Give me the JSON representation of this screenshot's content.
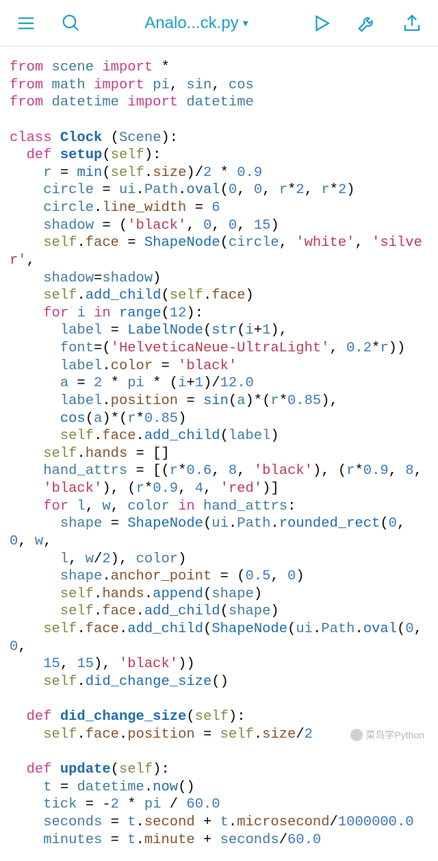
{
  "toolbar": {
    "title": "Analo...ck.py",
    "icons": {
      "menu": "hamburger-icon",
      "search": "search-icon",
      "play": "play-icon",
      "wrench": "wrench-icon",
      "export": "export-icon",
      "dropdown": "▾"
    }
  },
  "watermark": "菜鸟学Python",
  "code_tokens": [
    [
      [
        "kw",
        "from"
      ],
      [
        "op",
        " "
      ],
      [
        "nm",
        "scene"
      ],
      [
        "op",
        " "
      ],
      [
        "kw",
        "import"
      ],
      [
        "op",
        " *"
      ]
    ],
    [
      [
        "kw",
        "from"
      ],
      [
        "op",
        " "
      ],
      [
        "nm",
        "math"
      ],
      [
        "op",
        " "
      ],
      [
        "kw",
        "import"
      ],
      [
        "op",
        " "
      ],
      [
        "nm",
        "pi"
      ],
      [
        "op",
        ", "
      ],
      [
        "nm",
        "sin"
      ],
      [
        "op",
        ", "
      ],
      [
        "nm",
        "cos"
      ]
    ],
    [
      [
        "kw",
        "from"
      ],
      [
        "op",
        " "
      ],
      [
        "nm",
        "datetime"
      ],
      [
        "op",
        " "
      ],
      [
        "kw",
        "import"
      ],
      [
        "op",
        " "
      ],
      [
        "nm",
        "datetime"
      ]
    ],
    [],
    [
      [
        "kw",
        "class"
      ],
      [
        "op",
        " "
      ],
      [
        "cls",
        "Clock"
      ],
      [
        "op",
        " ("
      ],
      [
        "nm",
        "Scene"
      ],
      [
        "op",
        "):"
      ]
    ],
    [
      [
        "op",
        "  "
      ],
      [
        "kw",
        "def"
      ],
      [
        "op",
        " "
      ],
      [
        "fn",
        "setup"
      ],
      [
        "op",
        "("
      ],
      [
        "self",
        "self"
      ],
      [
        "op",
        "):"
      ]
    ],
    [
      [
        "op",
        "    "
      ],
      [
        "nm",
        "r"
      ],
      [
        "op",
        " = "
      ],
      [
        "call",
        "min"
      ],
      [
        "op",
        "("
      ],
      [
        "self",
        "self"
      ],
      [
        "op",
        "."
      ],
      [
        "attr",
        "size"
      ],
      [
        "op",
        ")/"
      ],
      [
        "num",
        "2"
      ],
      [
        "op",
        " * "
      ],
      [
        "num",
        "0.9"
      ]
    ],
    [
      [
        "op",
        "    "
      ],
      [
        "nm",
        "circle"
      ],
      [
        "op",
        " = "
      ],
      [
        "nm",
        "ui"
      ],
      [
        "op",
        "."
      ],
      [
        "nm",
        "Path"
      ],
      [
        "op",
        "."
      ],
      [
        "call",
        "oval"
      ],
      [
        "op",
        "("
      ],
      [
        "num",
        "0"
      ],
      [
        "op",
        ", "
      ],
      [
        "num",
        "0"
      ],
      [
        "op",
        ", "
      ],
      [
        "nm",
        "r"
      ],
      [
        "op",
        "*"
      ],
      [
        "num",
        "2"
      ],
      [
        "op",
        ", "
      ],
      [
        "nm",
        "r"
      ],
      [
        "op",
        "*"
      ],
      [
        "num",
        "2"
      ],
      [
        "op",
        ")"
      ]
    ],
    [
      [
        "op",
        "    "
      ],
      [
        "nm",
        "circle"
      ],
      [
        "op",
        "."
      ],
      [
        "attr",
        "line_width"
      ],
      [
        "op",
        " = "
      ],
      [
        "num",
        "6"
      ]
    ],
    [
      [
        "op",
        "    "
      ],
      [
        "nm",
        "shadow"
      ],
      [
        "op",
        " = ("
      ],
      [
        "str",
        "'black'"
      ],
      [
        "op",
        ", "
      ],
      [
        "num",
        "0"
      ],
      [
        "op",
        ", "
      ],
      [
        "num",
        "0"
      ],
      [
        "op",
        ", "
      ],
      [
        "num",
        "15"
      ],
      [
        "op",
        ")"
      ]
    ],
    [
      [
        "op",
        "    "
      ],
      [
        "self",
        "self"
      ],
      [
        "op",
        "."
      ],
      [
        "attr",
        "face"
      ],
      [
        "op",
        " = "
      ],
      [
        "call",
        "ShapeNode"
      ],
      [
        "op",
        "("
      ],
      [
        "nm",
        "circle"
      ],
      [
        "op",
        ", "
      ],
      [
        "str",
        "'white'"
      ],
      [
        "op",
        ", "
      ],
      [
        "str",
        "'silver'"
      ],
      [
        "op",
        ","
      ]
    ],
    [
      [
        "op",
        "    "
      ],
      [
        "nm",
        "shadow"
      ],
      [
        "op",
        "="
      ],
      [
        "nm",
        "shadow"
      ],
      [
        "op",
        ")"
      ]
    ],
    [
      [
        "op",
        "    "
      ],
      [
        "self",
        "self"
      ],
      [
        "op",
        "."
      ],
      [
        "call",
        "add_child"
      ],
      [
        "op",
        "("
      ],
      [
        "self",
        "self"
      ],
      [
        "op",
        "."
      ],
      [
        "attr",
        "face"
      ],
      [
        "op",
        ")"
      ]
    ],
    [
      [
        "op",
        "    "
      ],
      [
        "kw",
        "for"
      ],
      [
        "op",
        " "
      ],
      [
        "nm",
        "i"
      ],
      [
        "op",
        " "
      ],
      [
        "kw",
        "in"
      ],
      [
        "op",
        " "
      ],
      [
        "call",
        "range"
      ],
      [
        "op",
        "("
      ],
      [
        "num",
        "12"
      ],
      [
        "op",
        "):"
      ]
    ],
    [
      [
        "op",
        "      "
      ],
      [
        "nm",
        "label"
      ],
      [
        "op",
        " = "
      ],
      [
        "call",
        "LabelNode"
      ],
      [
        "op",
        "("
      ],
      [
        "call",
        "str"
      ],
      [
        "op",
        "("
      ],
      [
        "nm",
        "i"
      ],
      [
        "op",
        "+"
      ],
      [
        "num",
        "1"
      ],
      [
        "op",
        "),"
      ]
    ],
    [
      [
        "op",
        "      "
      ],
      [
        "nm",
        "font"
      ],
      [
        "op",
        "=("
      ],
      [
        "str",
        "'HelveticaNeue-UltraLight'"
      ],
      [
        "op",
        ", "
      ],
      [
        "num",
        "0.2"
      ],
      [
        "op",
        "*"
      ],
      [
        "nm",
        "r"
      ],
      [
        "op",
        "))"
      ]
    ],
    [
      [
        "op",
        "      "
      ],
      [
        "nm",
        "label"
      ],
      [
        "op",
        "."
      ],
      [
        "attr",
        "color"
      ],
      [
        "op",
        " = "
      ],
      [
        "str",
        "'black'"
      ]
    ],
    [
      [
        "op",
        "      "
      ],
      [
        "nm",
        "a"
      ],
      [
        "op",
        " = "
      ],
      [
        "num",
        "2"
      ],
      [
        "op",
        " * "
      ],
      [
        "nm",
        "pi"
      ],
      [
        "op",
        " * ("
      ],
      [
        "nm",
        "i"
      ],
      [
        "op",
        "+"
      ],
      [
        "num",
        "1"
      ],
      [
        "op",
        ")/"
      ],
      [
        "num",
        "12.0"
      ]
    ],
    [
      [
        "op",
        "      "
      ],
      [
        "nm",
        "label"
      ],
      [
        "op",
        "."
      ],
      [
        "attr",
        "position"
      ],
      [
        "op",
        " = "
      ],
      [
        "call",
        "sin"
      ],
      [
        "op",
        "("
      ],
      [
        "nm",
        "a"
      ],
      [
        "op",
        ")*("
      ],
      [
        "nm",
        "r"
      ],
      [
        "op",
        "*"
      ],
      [
        "num",
        "0.85"
      ],
      [
        "op",
        "),"
      ]
    ],
    [
      [
        "op",
        "      "
      ],
      [
        "call",
        "cos"
      ],
      [
        "op",
        "("
      ],
      [
        "nm",
        "a"
      ],
      [
        "op",
        ")*("
      ],
      [
        "nm",
        "r"
      ],
      [
        "op",
        "*"
      ],
      [
        "num",
        "0.85"
      ],
      [
        "op",
        ")"
      ]
    ],
    [
      [
        "op",
        "      "
      ],
      [
        "self",
        "self"
      ],
      [
        "op",
        "."
      ],
      [
        "attr",
        "face"
      ],
      [
        "op",
        "."
      ],
      [
        "call",
        "add_child"
      ],
      [
        "op",
        "("
      ],
      [
        "nm",
        "label"
      ],
      [
        "op",
        ")"
      ]
    ],
    [
      [
        "op",
        "    "
      ],
      [
        "self",
        "self"
      ],
      [
        "op",
        "."
      ],
      [
        "attr",
        "hands"
      ],
      [
        "op",
        " = []"
      ]
    ],
    [
      [
        "op",
        "    "
      ],
      [
        "nm",
        "hand_attrs"
      ],
      [
        "op",
        " = [("
      ],
      [
        "nm",
        "r"
      ],
      [
        "op",
        "*"
      ],
      [
        "num",
        "0.6"
      ],
      [
        "op",
        ", "
      ],
      [
        "num",
        "8"
      ],
      [
        "op",
        ", "
      ],
      [
        "str",
        "'black'"
      ],
      [
        "op",
        "), ("
      ],
      [
        "nm",
        "r"
      ],
      [
        "op",
        "*"
      ],
      [
        "num",
        "0.9"
      ],
      [
        "op",
        ", "
      ],
      [
        "num",
        "8"
      ],
      [
        "op",
        ","
      ]
    ],
    [
      [
        "op",
        "    "
      ],
      [
        "str",
        "'black'"
      ],
      [
        "op",
        "), ("
      ],
      [
        "nm",
        "r"
      ],
      [
        "op",
        "*"
      ],
      [
        "num",
        "0.9"
      ],
      [
        "op",
        ", "
      ],
      [
        "num",
        "4"
      ],
      [
        "op",
        ", "
      ],
      [
        "str",
        "'red'"
      ],
      [
        "op",
        ")]"
      ]
    ],
    [
      [
        "op",
        "    "
      ],
      [
        "kw",
        "for"
      ],
      [
        "op",
        " "
      ],
      [
        "nm",
        "l"
      ],
      [
        "op",
        ", "
      ],
      [
        "nm",
        "w"
      ],
      [
        "op",
        ", "
      ],
      [
        "nm",
        "color"
      ],
      [
        "op",
        " "
      ],
      [
        "kw",
        "in"
      ],
      [
        "op",
        " "
      ],
      [
        "nm",
        "hand_attrs"
      ],
      [
        "op",
        ":"
      ]
    ],
    [
      [
        "op",
        "      "
      ],
      [
        "nm",
        "shape"
      ],
      [
        "op",
        " = "
      ],
      [
        "call",
        "ShapeNode"
      ],
      [
        "op",
        "("
      ],
      [
        "nm",
        "ui"
      ],
      [
        "op",
        "."
      ],
      [
        "nm",
        "Path"
      ],
      [
        "op",
        "."
      ],
      [
        "call",
        "rounded_rect"
      ],
      [
        "op",
        "("
      ],
      [
        "num",
        "0"
      ],
      [
        "op",
        ", "
      ],
      [
        "num",
        "0"
      ],
      [
        "op",
        ", "
      ],
      [
        "nm",
        "w"
      ],
      [
        "op",
        ","
      ]
    ],
    [
      [
        "op",
        "      "
      ],
      [
        "nm",
        "l"
      ],
      [
        "op",
        ", "
      ],
      [
        "nm",
        "w"
      ],
      [
        "op",
        "/"
      ],
      [
        "num",
        "2"
      ],
      [
        "op",
        "), "
      ],
      [
        "nm",
        "color"
      ],
      [
        "op",
        ")"
      ]
    ],
    [
      [
        "op",
        "      "
      ],
      [
        "nm",
        "shape"
      ],
      [
        "op",
        "."
      ],
      [
        "attr",
        "anchor_point"
      ],
      [
        "op",
        " = ("
      ],
      [
        "num",
        "0.5"
      ],
      [
        "op",
        ", "
      ],
      [
        "num",
        "0"
      ],
      [
        "op",
        ")"
      ]
    ],
    [
      [
        "op",
        "      "
      ],
      [
        "self",
        "self"
      ],
      [
        "op",
        "."
      ],
      [
        "attr",
        "hands"
      ],
      [
        "op",
        "."
      ],
      [
        "call",
        "append"
      ],
      [
        "op",
        "("
      ],
      [
        "nm",
        "shape"
      ],
      [
        "op",
        ")"
      ]
    ],
    [
      [
        "op",
        "      "
      ],
      [
        "self",
        "self"
      ],
      [
        "op",
        "."
      ],
      [
        "attr",
        "face"
      ],
      [
        "op",
        "."
      ],
      [
        "call",
        "add_child"
      ],
      [
        "op",
        "("
      ],
      [
        "nm",
        "shape"
      ],
      [
        "op",
        ")"
      ]
    ],
    [
      [
        "op",
        "    "
      ],
      [
        "self",
        "self"
      ],
      [
        "op",
        "."
      ],
      [
        "attr",
        "face"
      ],
      [
        "op",
        "."
      ],
      [
        "call",
        "add_child"
      ],
      [
        "op",
        "("
      ],
      [
        "call",
        "ShapeNode"
      ],
      [
        "op",
        "("
      ],
      [
        "nm",
        "ui"
      ],
      [
        "op",
        "."
      ],
      [
        "nm",
        "Path"
      ],
      [
        "op",
        "."
      ],
      [
        "call",
        "oval"
      ],
      [
        "op",
        "("
      ],
      [
        "num",
        "0"
      ],
      [
        "op",
        ", "
      ],
      [
        "num",
        "0"
      ],
      [
        "op",
        ","
      ]
    ],
    [
      [
        "op",
        "    "
      ],
      [
        "num",
        "15"
      ],
      [
        "op",
        ", "
      ],
      [
        "num",
        "15"
      ],
      [
        "op",
        "), "
      ],
      [
        "str",
        "'black'"
      ],
      [
        "op",
        "))"
      ]
    ],
    [
      [
        "op",
        "    "
      ],
      [
        "self",
        "self"
      ],
      [
        "op",
        "."
      ],
      [
        "call",
        "did_change_size"
      ],
      [
        "op",
        "()"
      ]
    ],
    [],
    [
      [
        "op",
        "  "
      ],
      [
        "kw",
        "def"
      ],
      [
        "op",
        " "
      ],
      [
        "fn",
        "did_change_size"
      ],
      [
        "op",
        "("
      ],
      [
        "self",
        "self"
      ],
      [
        "op",
        "):"
      ]
    ],
    [
      [
        "op",
        "    "
      ],
      [
        "self",
        "self"
      ],
      [
        "op",
        "."
      ],
      [
        "attr",
        "face"
      ],
      [
        "op",
        "."
      ],
      [
        "attr",
        "position"
      ],
      [
        "op",
        " = "
      ],
      [
        "self",
        "self"
      ],
      [
        "op",
        "."
      ],
      [
        "attr",
        "size"
      ],
      [
        "op",
        "/"
      ],
      [
        "num",
        "2"
      ]
    ],
    [],
    [
      [
        "op",
        "  "
      ],
      [
        "kw",
        "def"
      ],
      [
        "op",
        " "
      ],
      [
        "fn",
        "update"
      ],
      [
        "op",
        "("
      ],
      [
        "self",
        "self"
      ],
      [
        "op",
        "):"
      ]
    ],
    [
      [
        "op",
        "    "
      ],
      [
        "nm",
        "t"
      ],
      [
        "op",
        " = "
      ],
      [
        "nm",
        "datetime"
      ],
      [
        "op",
        "."
      ],
      [
        "call",
        "now"
      ],
      [
        "op",
        "()"
      ]
    ],
    [
      [
        "op",
        "    "
      ],
      [
        "nm",
        "tick"
      ],
      [
        "op",
        " = "
      ],
      [
        "op",
        "-"
      ],
      [
        "num",
        "2"
      ],
      [
        "op",
        " * "
      ],
      [
        "nm",
        "pi"
      ],
      [
        "op",
        " / "
      ],
      [
        "num",
        "60.0"
      ]
    ],
    [
      [
        "op",
        "    "
      ],
      [
        "nm",
        "seconds"
      ],
      [
        "op",
        " = "
      ],
      [
        "nm",
        "t"
      ],
      [
        "op",
        "."
      ],
      [
        "attr",
        "second"
      ],
      [
        "op",
        " + "
      ],
      [
        "nm",
        "t"
      ],
      [
        "op",
        "."
      ],
      [
        "attr",
        "microsecond"
      ],
      [
        "op",
        "/"
      ],
      [
        "num",
        "1000000.0"
      ]
    ],
    [
      [
        "op",
        "    "
      ],
      [
        "nm",
        "minutes"
      ],
      [
        "op",
        " = "
      ],
      [
        "nm",
        "t"
      ],
      [
        "op",
        "."
      ],
      [
        "attr",
        "minute"
      ],
      [
        "op",
        " + "
      ],
      [
        "nm",
        "seconds"
      ],
      [
        "op",
        "/"
      ],
      [
        "num",
        "60.0"
      ]
    ]
  ]
}
